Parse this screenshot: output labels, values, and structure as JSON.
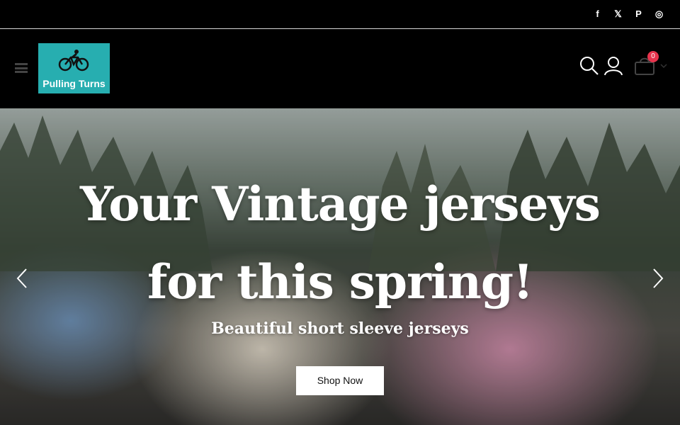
{
  "social": {
    "icons": [
      "facebook-icon",
      "x-icon",
      "pinterest-icon",
      "instagram-icon"
    ],
    "glyphs": [
      "f",
      "𝕏",
      "P",
      "◎"
    ]
  },
  "header": {
    "logo_text": "Pulling Turns",
    "cart_count": "0"
  },
  "hero": {
    "headline_line1": "Your Vintage jerseys",
    "headline_line2": "for this spring!",
    "subtitle": "Beautiful short sleeve jerseys",
    "cta_label": "Shop Now"
  },
  "colors": {
    "logo_bg": "#27aeb0",
    "badge": "#e8344d",
    "topbar": "#000000"
  }
}
